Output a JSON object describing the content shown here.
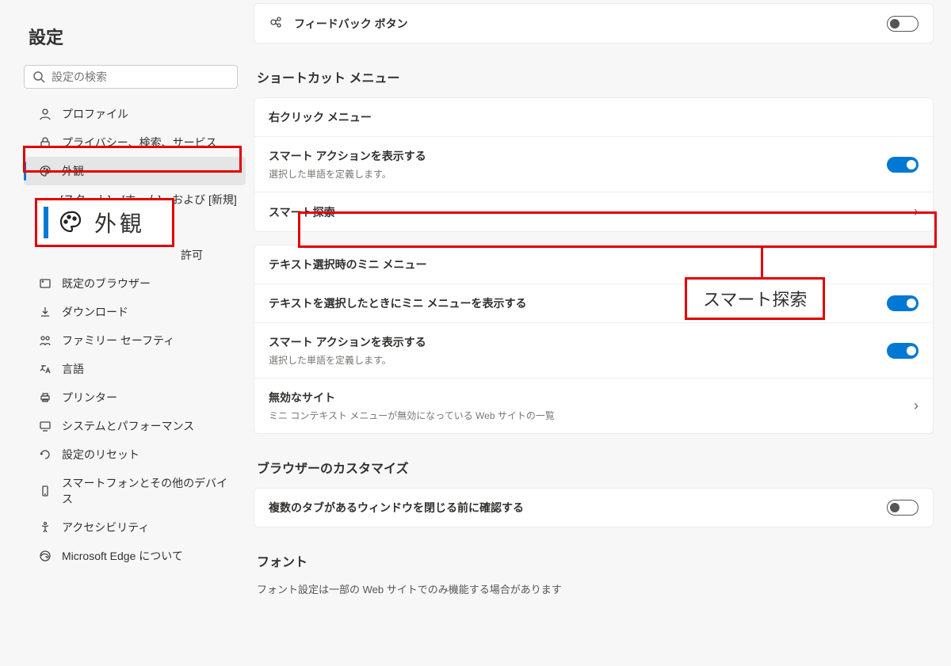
{
  "sidebar": {
    "title": "設定",
    "search_placeholder": "設定の検索",
    "items": [
      {
        "label": "プロファイル"
      },
      {
        "label": "プライバシー、検索、サービス"
      },
      {
        "label": "外観"
      },
      {
        "label": "[スタート]、[ホーム]、および [新規] タブ"
      },
      {
        "label": "許可",
        "hidden_suffix": true
      },
      {
        "label": "既定のブラウザー"
      },
      {
        "label": "ダウンロード"
      },
      {
        "label": "ファミリー セーフティ"
      },
      {
        "label": "言語"
      },
      {
        "label": "プリンター"
      },
      {
        "label": "システムとパフォーマンス"
      },
      {
        "label": "設定のリセット"
      },
      {
        "label": "スマートフォンとその他のデバイス"
      },
      {
        "label": "アクセシビリティ"
      },
      {
        "label": "Microsoft Edge について"
      }
    ]
  },
  "callout1": "外観",
  "callout2": "スマート探索",
  "main": {
    "feedback": {
      "label": "フィードバック ボタン"
    },
    "shortcut_menu": {
      "title": "ショートカット メニュー",
      "right_click": "右クリック メニュー",
      "smart_actions_title": "スマート アクションを表示する",
      "smart_actions_sub": "選択した単語を定義します。",
      "smart_explore": "スマート探索",
      "mini_menu_header": "テキスト選択時のミニ メニュー",
      "mini_menu_show": "テキストを選択したときにミニ メニューを表示する",
      "smart_actions2_title": "スマート アクションを表示する",
      "smart_actions2_sub": "選択した単語を定義します。",
      "disabled_sites_title": "無効なサイト",
      "disabled_sites_sub": "ミニ コンテキスト メニューが無効になっている Web サイトの一覧"
    },
    "customize": {
      "title": "ブラウザーのカスタマイズ",
      "confirm_close": "複数のタブがあるウィンドウを閉じる前に確認する"
    },
    "font": {
      "title": "フォント",
      "desc": "フォント設定は一部の Web サイトでのみ機能する場合があります"
    }
  }
}
